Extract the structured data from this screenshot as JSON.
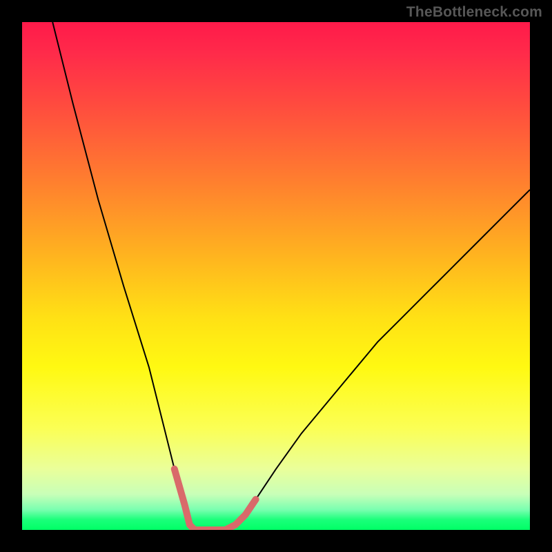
{
  "watermark": "TheBottleneck.com",
  "chart_data": {
    "type": "line",
    "title": "",
    "xlabel": "",
    "ylabel": "",
    "xlim": [
      0,
      100
    ],
    "ylim": [
      0,
      100
    ],
    "grid": false,
    "legend": false,
    "background_gradient": {
      "top": "#ff1a4a",
      "mid": "#ffe015",
      "bottom": "#00ff66"
    },
    "series": [
      {
        "name": "bottleneck-curve",
        "color": "#000000",
        "stroke_width": 2,
        "x": [
          6,
          10,
          15,
          20,
          25,
          28,
          30,
          32,
          33,
          34,
          36,
          38,
          40,
          42,
          44,
          46,
          50,
          55,
          60,
          65,
          70,
          75,
          80,
          85,
          90,
          95,
          100
        ],
        "y": [
          100,
          84,
          65,
          48,
          32,
          20,
          12,
          5,
          1,
          0,
          0,
          0,
          0,
          1,
          3,
          6,
          12,
          19,
          25,
          31,
          37,
          42,
          47,
          52,
          57,
          62,
          67
        ]
      },
      {
        "name": "bottom-highlight",
        "color": "#d96a6a",
        "stroke_width": 10,
        "x": [
          30,
          32,
          33,
          34,
          36,
          38,
          40,
          42,
          44,
          46
        ],
        "y": [
          12,
          5,
          1,
          0,
          0,
          0,
          0,
          1,
          3,
          6
        ]
      }
    ]
  }
}
